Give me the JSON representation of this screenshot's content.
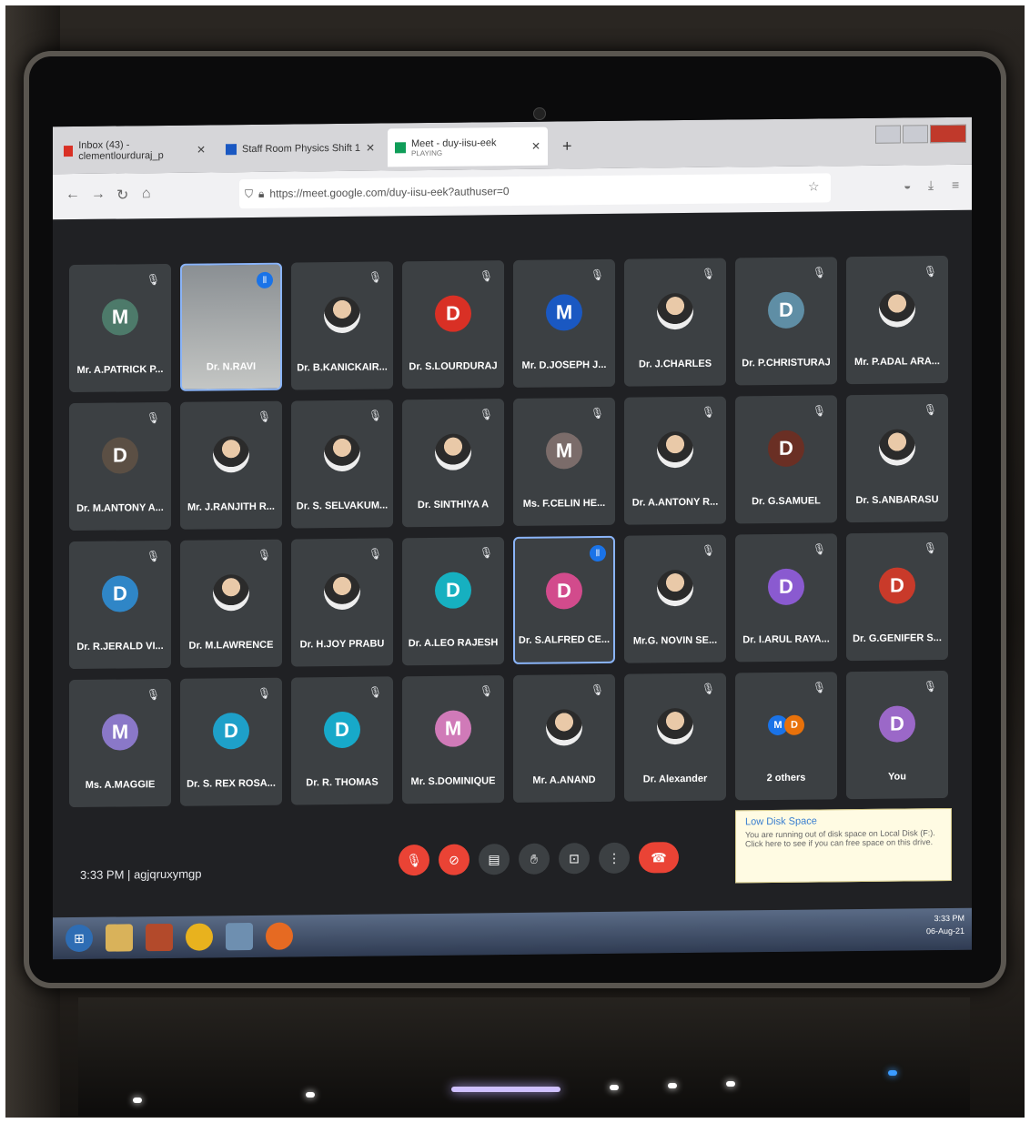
{
  "browser": {
    "tabs": [
      {
        "label": "Inbox (43) - clementlourduraj_p",
        "close": "✕"
      },
      {
        "label": "Staff Room Physics Shift 1",
        "close": "✕"
      },
      {
        "label": "Meet - duy-iisu-eek",
        "sub": "PLAYING",
        "close": "✕"
      }
    ],
    "new_tab": "+",
    "url": "https://meet.google.com/duy-iisu-eek?authuser=0"
  },
  "participants": [
    {
      "name": "Mr. A.PATRICK P...",
      "initial": "M",
      "color": "#4d7a6a"
    },
    {
      "name": "Dr. N.RAVI",
      "initial": "",
      "color": "",
      "video": true
    },
    {
      "name": "Dr. B.KANICKAIR...",
      "initial": "",
      "color": "",
      "photo": true
    },
    {
      "name": "Dr. S.LOURDURAJ",
      "initial": "D",
      "color": "#d93025"
    },
    {
      "name": "Mr. D.JOSEPH J...",
      "initial": "M",
      "color": "#1a58c2"
    },
    {
      "name": "Dr. J.CHARLES",
      "initial": "",
      "color": "",
      "photo": true
    },
    {
      "name": "Dr. P.CHRISTURAJ",
      "initial": "D",
      "color": "#5f8ea5"
    },
    {
      "name": "Mr. P.ADAL ARA...",
      "initial": "",
      "color": "",
      "photo": true
    },
    {
      "name": "Dr. M.ANTONY A...",
      "initial": "D",
      "color": "#5b4f44"
    },
    {
      "name": "Mr. J.RANJITH R...",
      "initial": "",
      "color": "",
      "photo": true
    },
    {
      "name": "Dr. S. SELVAKUM...",
      "initial": "",
      "color": "",
      "photo": true
    },
    {
      "name": "Dr. SINTHIYA A",
      "initial": "",
      "color": "",
      "photo": true
    },
    {
      "name": "Ms. F.CELIN HE...",
      "initial": "M",
      "color": "#7b6c6a"
    },
    {
      "name": "Dr. A.ANTONY R...",
      "initial": "",
      "color": "",
      "photo": true
    },
    {
      "name": "Dr. G.SAMUEL",
      "initial": "D",
      "color": "#6a2f24"
    },
    {
      "name": "Dr. S.ANBARASU",
      "initial": "",
      "color": "",
      "photo": true
    },
    {
      "name": "Dr. R.JERALD VI...",
      "initial": "D",
      "color": "#2f86c7"
    },
    {
      "name": "Dr. M.LAWRENCE",
      "initial": "",
      "color": "",
      "photo": true
    },
    {
      "name": "Dr. H.JOY PRABU",
      "initial": "",
      "color": "",
      "photo": true
    },
    {
      "name": "Dr. A.LEO RAJESH",
      "initial": "D",
      "color": "#16b0c0"
    },
    {
      "name": "Dr. S.ALFRED CE...",
      "initial": "D",
      "color": "#d24b8c",
      "speaking": true
    },
    {
      "name": "Mr.G. NOVIN SE...",
      "initial": "",
      "color": "",
      "photo": true
    },
    {
      "name": "Dr. I.ARUL RAYA...",
      "initial": "D",
      "color": "#8a5ad0"
    },
    {
      "name": "Dr. G.GENIFER S...",
      "initial": "D",
      "color": "#c93a2a"
    },
    {
      "name": "Ms. A.MAGGIE",
      "initial": "M",
      "color": "#8a78c8"
    },
    {
      "name": "Dr. S. REX ROSA...",
      "initial": "D",
      "color": "#1ea0c9"
    },
    {
      "name": "Dr. R. THOMAS",
      "initial": "D",
      "color": "#17a9c9"
    },
    {
      "name": "Mr. S.DOMINIQUE",
      "initial": "M",
      "color": "#d07ab8"
    },
    {
      "name": "Mr. A.ANAND",
      "initial": "",
      "color": "",
      "photo": true
    },
    {
      "name": "Dr. Alexander",
      "initial": "",
      "color": "",
      "photo": true
    },
    {
      "name": "2 others",
      "initial": "",
      "color": "",
      "others": true
    },
    {
      "name": "You",
      "initial": "D",
      "color": "#9b68c8"
    }
  ],
  "meeting": {
    "time": "3:33 PM",
    "separator": "|",
    "code": "agjqruxymgp"
  },
  "toast": {
    "title": "Low Disk Space",
    "body": "You are running out of disk space on Local Disk (F:). Click here to see if you can free space on this drive."
  },
  "tray": {
    "time": "3:33 PM",
    "date": "06-Aug-21"
  },
  "icons": {
    "mic_muted": "mic-off-icon",
    "back": "back-arrow-icon",
    "forward": "forward-arrow-icon",
    "reload": "reload-icon",
    "home": "home-icon"
  }
}
